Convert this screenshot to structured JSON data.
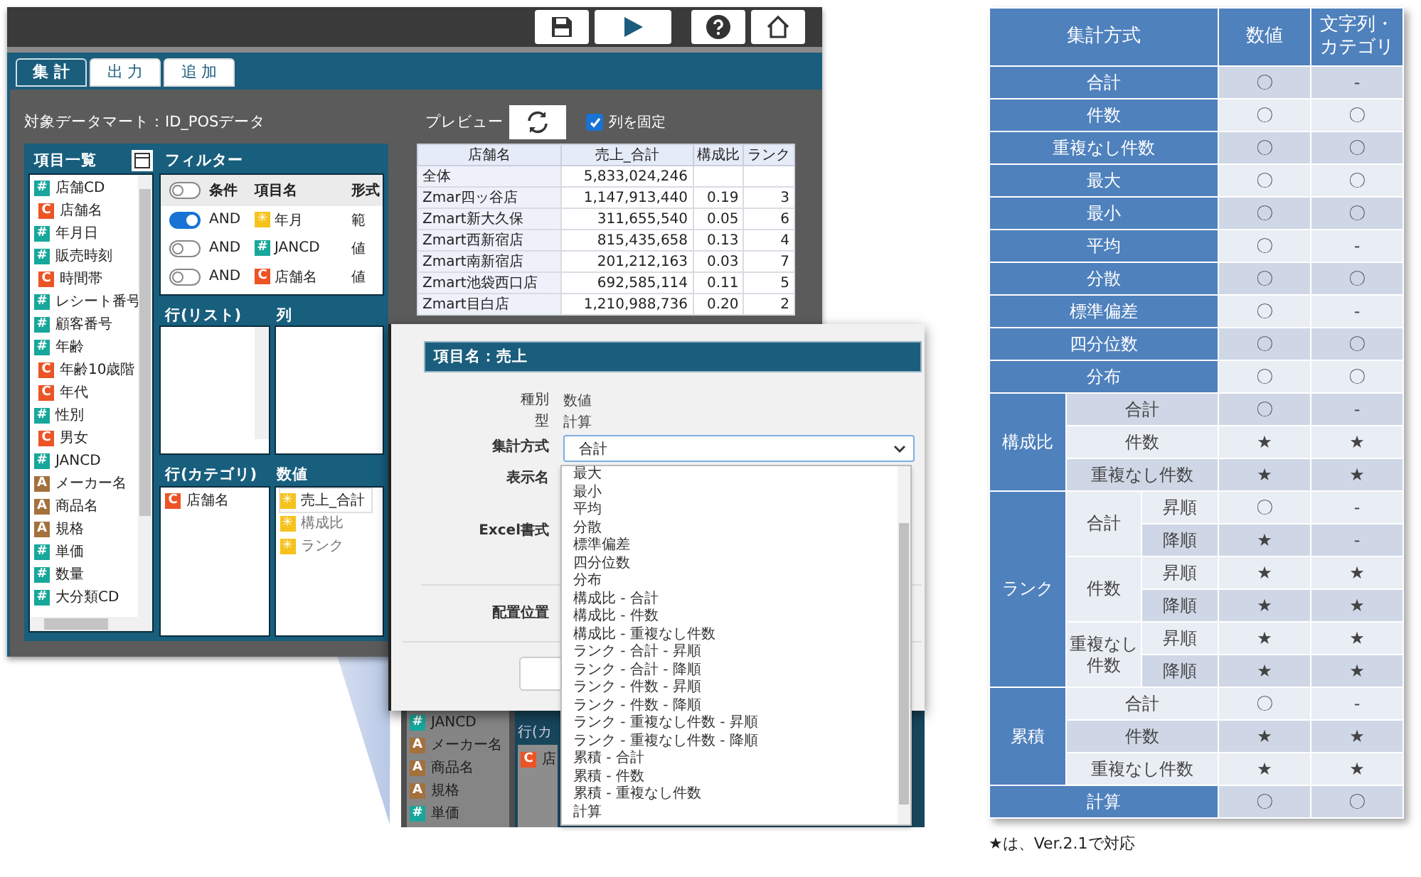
{
  "toolbar": [
    {
      "kind": "save"
    },
    {
      "kind": "play"
    },
    {
      "kind": "help"
    },
    {
      "kind": "home"
    }
  ],
  "tabs": [
    {
      "label": "集 計",
      "selected": true
    },
    {
      "label": "出 力",
      "selected": false
    },
    {
      "label": "追 加",
      "selected": false
    }
  ],
  "datamart": "対象データマート：ID_POSデータ",
  "item_list": {
    "title": "項目一覧",
    "items": [
      {
        "kind": "number",
        "badge": "#",
        "label": "店舗CD"
      },
      {
        "kind": "category",
        "badge": "C",
        "label": "店舗名"
      },
      {
        "kind": "number",
        "badge": "#",
        "label": "年月日"
      },
      {
        "kind": "number",
        "badge": "#",
        "label": "販売時刻"
      },
      {
        "kind": "category",
        "badge": "C",
        "label": "時間帯"
      },
      {
        "kind": "number",
        "badge": "#",
        "label": "レシート番号"
      },
      {
        "kind": "number",
        "badge": "#",
        "label": "顧客番号"
      },
      {
        "kind": "number",
        "badge": "#",
        "label": "年齢"
      },
      {
        "kind": "category",
        "badge": "C",
        "label": "年齢10歳階"
      },
      {
        "kind": "category",
        "badge": "C",
        "label": "年代"
      },
      {
        "kind": "number",
        "badge": "#",
        "label": "性別"
      },
      {
        "kind": "category",
        "badge": "C",
        "label": "男女"
      },
      {
        "kind": "number",
        "badge": "#",
        "label": "JANCD"
      },
      {
        "kind": "attribute",
        "badge": "A",
        "label": "メーカー名"
      },
      {
        "kind": "attribute",
        "badge": "A",
        "label": "商品名"
      },
      {
        "kind": "attribute",
        "badge": "A",
        "label": "規格"
      },
      {
        "kind": "number",
        "badge": "#",
        "label": "単価"
      },
      {
        "kind": "number",
        "badge": "#",
        "label": "数量"
      },
      {
        "kind": "number",
        "badge": "#",
        "label": "大分類CD"
      }
    ]
  },
  "filter": {
    "title": "フィルター",
    "header_toggle_on": false,
    "columns": [
      "条件",
      "項目名",
      "形式"
    ],
    "rows": [
      {
        "on": true,
        "conjunction": "AND",
        "kind": "measure",
        "badge": "✳",
        "label": "年月",
        "format": "範"
      },
      {
        "on": false,
        "conjunction": "AND",
        "kind": "number",
        "badge": "#",
        "label": "JANCD",
        "format": "値"
      },
      {
        "on": false,
        "conjunction": "AND",
        "kind": "category",
        "badge": "C",
        "label": "店舗名",
        "format": "値"
      }
    ]
  },
  "row_list": {
    "title": "行(リスト)"
  },
  "columns_box": {
    "title": "列"
  },
  "row_category": {
    "title": "行(カテゴリ)",
    "items": [
      {
        "kind": "category",
        "badge": "C",
        "label": "店舗名"
      }
    ]
  },
  "values": {
    "title": "数値",
    "items": [
      {
        "kind": "measure",
        "badge": "✳",
        "label": "売上_合計",
        "selected": true
      },
      {
        "kind": "measure",
        "badge": "✳",
        "label": "構成比",
        "selected": false
      },
      {
        "kind": "measure",
        "badge": "✳",
        "label": "ランク",
        "selected": false
      }
    ]
  },
  "preview": {
    "title": "プレビュー",
    "fix_columns": {
      "label": "列を固定",
      "checked": true
    },
    "columns": [
      "店舗名",
      "売上_合計",
      "構成比",
      "ランク"
    ],
    "rows": [
      [
        "全体",
        "5,833,024,246"
      ],
      [
        "Zmar四ッ谷店",
        "1,147,913,440",
        "0.19",
        "3"
      ],
      [
        "Zmart新大久保",
        "311,655,540",
        "0.05",
        "6"
      ],
      [
        "Zmart西新宿店",
        "815,435,658",
        "0.13",
        "4"
      ],
      [
        "Zmart南新宿店",
        "201,212,163",
        "0.03",
        "7"
      ],
      [
        "Zmart池袋西口店",
        "692,585,114",
        "0.11",
        "5"
      ],
      [
        "Zmart目白店",
        "1,210,988,736",
        "0.20",
        "2"
      ]
    ]
  },
  "backdrop": {
    "items": [
      {
        "kind": "number",
        "badge": "#",
        "label": "JANCD"
      },
      {
        "kind": "attribute",
        "badge": "A",
        "label": "メーカー名"
      },
      {
        "kind": "attribute",
        "badge": "A",
        "label": "商品名"
      },
      {
        "kind": "attribute",
        "badge": "A",
        "label": "規格"
      },
      {
        "kind": "number",
        "badge": "#",
        "label": "単価"
      }
    ],
    "panel_title": "行(カ",
    "panel_item": {
      "kind": "category",
      "badge": "C",
      "label": "店"
    }
  },
  "dialog": {
    "title": "項目名：売上",
    "fields": [
      {
        "label": "種別",
        "value": "数値"
      },
      {
        "label": "型",
        "value": "計算"
      }
    ],
    "method_label": "集計方式",
    "method_value": "合計",
    "labels_below": [
      "表示名",
      "Excel書式"
    ],
    "position_label": "配置位置",
    "options": [
      "最大",
      "最小",
      "平均",
      "分散",
      "標準偏差",
      "四分位数",
      "分布",
      "構成比 - 合計",
      "構成比 - 件数",
      "構成比 - 重複なし件数",
      "ランク - 合計 - 昇順",
      "ランク - 合計 - 降順",
      "ランク - 件数 - 昇順",
      "ランク - 件数 - 降順",
      "ランク - 重複なし件数 - 昇順",
      "ランク - 重複なし件数 - 降順",
      "累積 - 合計",
      "累積 - 件数",
      "累積 - 重複なし件数",
      "計算"
    ]
  },
  "methods_table": {
    "columns": [
      "集計方式",
      "数値",
      "文字列・カテゴリ"
    ],
    "entries": [
      {
        "kind": "single",
        "label": "合計",
        "numeric": "〇",
        "text": "-"
      },
      {
        "kind": "single",
        "label": "件数",
        "numeric": "〇",
        "text": "〇"
      },
      {
        "kind": "single",
        "label": "重複なし件数",
        "numeric": "〇",
        "text": "〇"
      },
      {
        "kind": "single",
        "label": "最大",
        "numeric": "〇",
        "text": "〇"
      },
      {
        "kind": "single",
        "label": "最小",
        "numeric": "〇",
        "text": "〇"
      },
      {
        "kind": "single",
        "label": "平均",
        "numeric": "〇",
        "text": "-"
      },
      {
        "kind": "single",
        "label": "分散",
        "numeric": "〇",
        "text": "〇"
      },
      {
        "kind": "single",
        "label": "標準偏差",
        "numeric": "〇",
        "text": "-"
      },
      {
        "kind": "single",
        "label": "四分位数",
        "numeric": "〇",
        "text": "〇"
      },
      {
        "kind": "single",
        "label": "分布",
        "numeric": "〇",
        "text": "〇"
      },
      {
        "kind": "group",
        "label": "構成比",
        "rows": [
          {
            "label": "合計",
            "numeric": "〇",
            "text": "-"
          },
          {
            "label": "件数",
            "numeric": "★",
            "text": "★"
          },
          {
            "label": "重複なし件数",
            "numeric": "★",
            "text": "★"
          }
        ]
      },
      {
        "kind": "nested",
        "label": "ランク",
        "groups": [
          {
            "label": "合計",
            "rows": [
              {
                "label": "昇順",
                "numeric": "〇",
                "text": "-"
              },
              {
                "label": "降順",
                "numeric": "★",
                "text": "-"
              }
            ]
          },
          {
            "label": "件数",
            "rows": [
              {
                "label": "昇順",
                "numeric": "★",
                "text": "★"
              },
              {
                "label": "降順",
                "numeric": "★",
                "text": "★"
              }
            ]
          },
          {
            "label": "重複なし件数",
            "rows": [
              {
                "label": "昇順",
                "numeric": "★",
                "text": "★"
              },
              {
                "label": "降順",
                "numeric": "★",
                "text": "★"
              }
            ]
          }
        ]
      },
      {
        "kind": "group",
        "label": "累積",
        "rows": [
          {
            "label": "合計",
            "numeric": "〇",
            "text": "-"
          },
          {
            "label": "件数",
            "numeric": "★",
            "text": "★"
          },
          {
            "label": "重複なし件数",
            "numeric": "★",
            "text": "★"
          }
        ]
      },
      {
        "kind": "single",
        "label": "計算",
        "numeric": "〇",
        "text": "〇"
      }
    ]
  },
  "footnote": "★は、Ver.2.1で対応"
}
